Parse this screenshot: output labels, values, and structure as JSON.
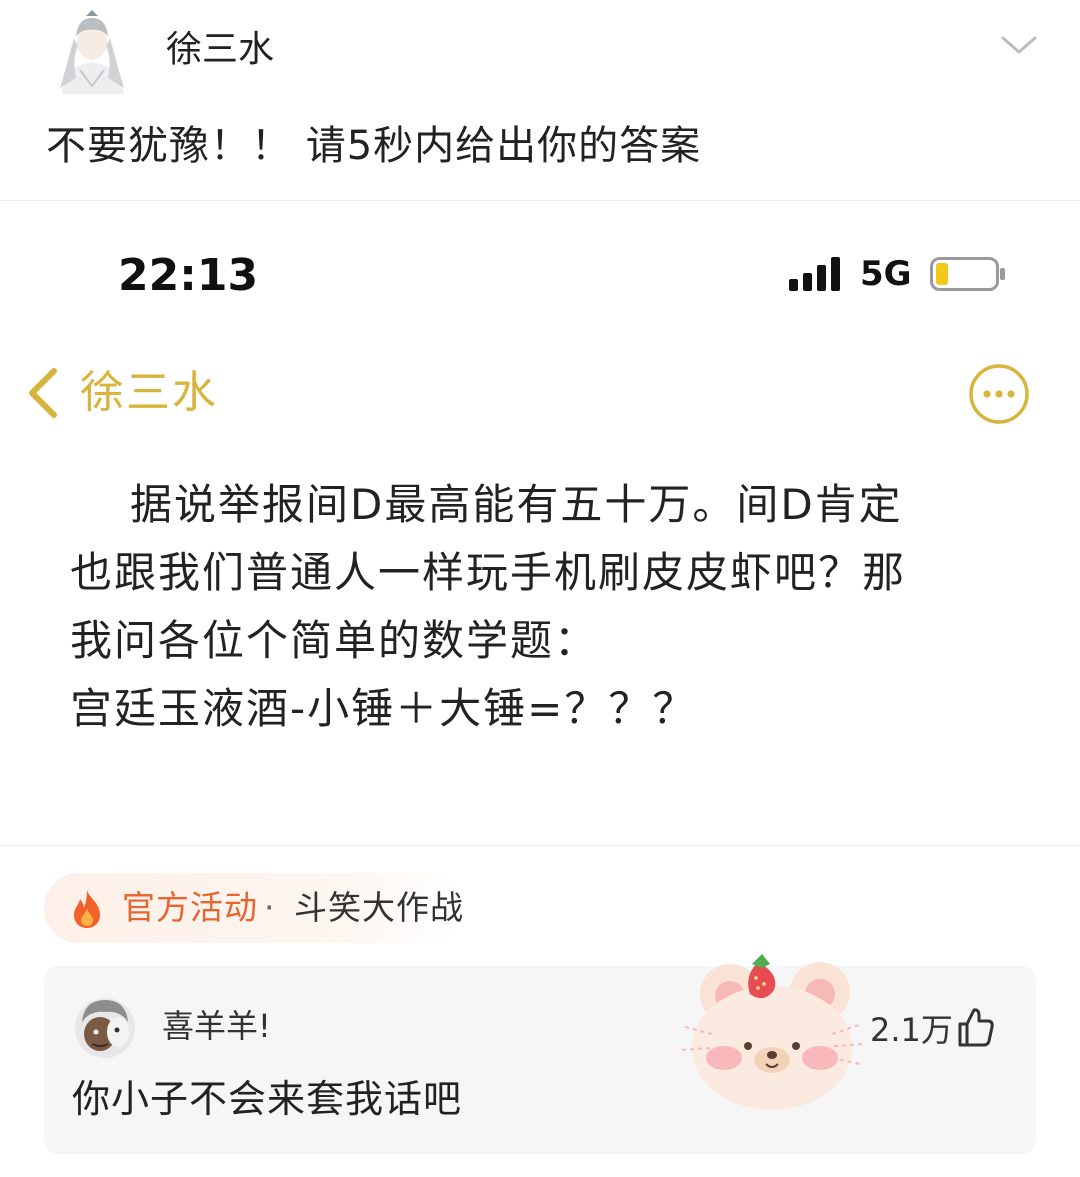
{
  "post": {
    "author": "徐三水",
    "caption": "不要犹豫！！ 请5秒内给出你的答案"
  },
  "screenshot": {
    "status_bar": {
      "time": "22:13",
      "network": "5G"
    },
    "chat_title": "徐三水",
    "message_lines": [
      "据说举报间D最高能有五十万。间D肯定",
      "也跟我们普通人一样玩手机刷皮皮虾吧？那",
      "我问各位个简单的数学题：",
      "宫廷玉液酒-小锤＋大锤=？？？"
    ]
  },
  "activity": {
    "label": "官方活动",
    "separator": "·",
    "name": "斗笑大作战"
  },
  "comment": {
    "user": "喜羊羊!",
    "text": "你小子不会来套我话吧",
    "likes": "2.1万"
  },
  "colors": {
    "accent_gold": "#d7b43c",
    "activity_orange": "#e8652f"
  },
  "icons": [
    "avatar",
    "chevron-down-icon",
    "signal-icon",
    "battery-icon",
    "back-chevron-icon",
    "more-icon",
    "fire-icon",
    "like-icon"
  ]
}
